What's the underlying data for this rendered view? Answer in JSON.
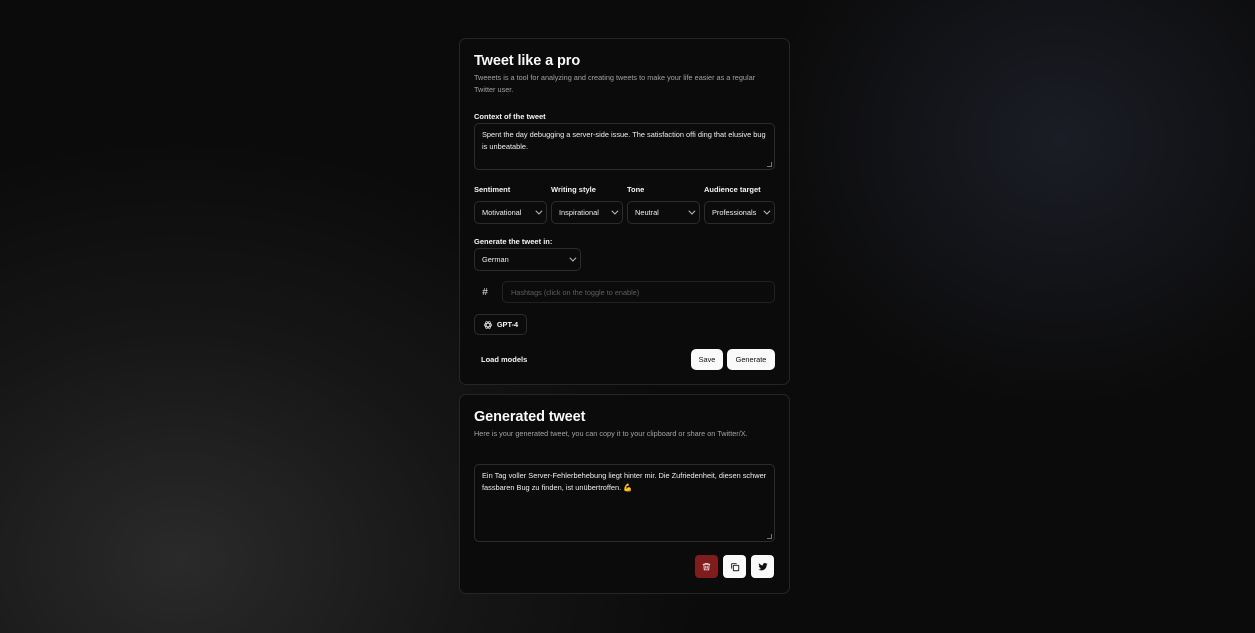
{
  "composer": {
    "title": "Tweet like a pro",
    "description": "Tweeets is a tool for analyzing and creating tweets to make your life easier as a regular Twitter user.",
    "context_label": "Context of the tweet",
    "context_value": "Spent the day debugging a server-side issue. The satisfaction offi ding that elusive bug is unbeatable.",
    "selects": [
      {
        "label": "Sentiment",
        "value": "Motivational"
      },
      {
        "label": "Writing style",
        "value": "Inspirational"
      },
      {
        "label": "Tone",
        "value": "Neutral"
      },
      {
        "label": "Audience target",
        "value": "Professionals"
      }
    ],
    "language_label": "Generate the tweet in:",
    "language_value": "German",
    "hashtag_symbol": "#",
    "hashtags_placeholder": "Hashtags (click on the toggle to enable)",
    "model_label": "GPT-4",
    "load_models_label": "Load models",
    "save_label": "Save",
    "generate_label": "Generate"
  },
  "result": {
    "title": "Generated tweet",
    "description": "Here is your generated tweet, you can copy it to your clipboard or share on Twitter/X.",
    "tweet_text": "Ein Tag voller Server-Fehlerbehebung liegt hinter mir. Die Zufriedenheit, diesen schwer fassbaren Bug zu finden, ist unübertroffen. 💪",
    "delete_color": "#7f1d1d"
  }
}
